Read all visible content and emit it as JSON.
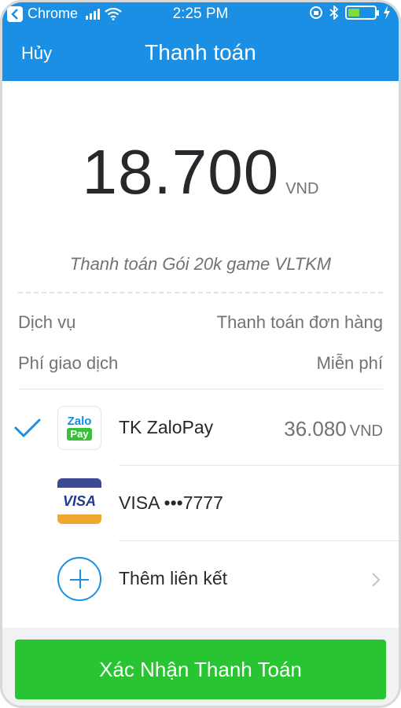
{
  "status_bar": {
    "carrier": "Chrome",
    "time": "2:25 PM",
    "battery_level": 0.45
  },
  "nav": {
    "cancel_label": "Hủy",
    "title": "Thanh toán"
  },
  "payment": {
    "amount": "18.700",
    "currency": "VND",
    "description": "Thanh toán Gói 20k game VLTKM"
  },
  "details": [
    {
      "label": "Dịch vụ",
      "value": "Thanh toán đơn hàng"
    },
    {
      "label": "Phí giao dịch",
      "value": "Miễn phí"
    }
  ],
  "methods": {
    "zalopay": {
      "icon": "zalopay-logo",
      "icon_text_top": "Zalo",
      "icon_text_bottom": "Pay",
      "label": "TK ZaloPay",
      "balance": "36.080",
      "balance_unit": "VND",
      "selected": true
    },
    "visa": {
      "icon": "visa-card-logo",
      "icon_text": "VISA",
      "label": "VISA •••7777"
    },
    "add": {
      "icon": "plus-circle-icon",
      "label": "Thêm liên kết"
    }
  },
  "confirm_label": "Xác Nhận Thanh Toán",
  "colors": {
    "primary_blue": "#1a8fe3",
    "confirm_green": "#28c431",
    "text_dark": "#26282c",
    "text_gray": "#6f7378"
  }
}
